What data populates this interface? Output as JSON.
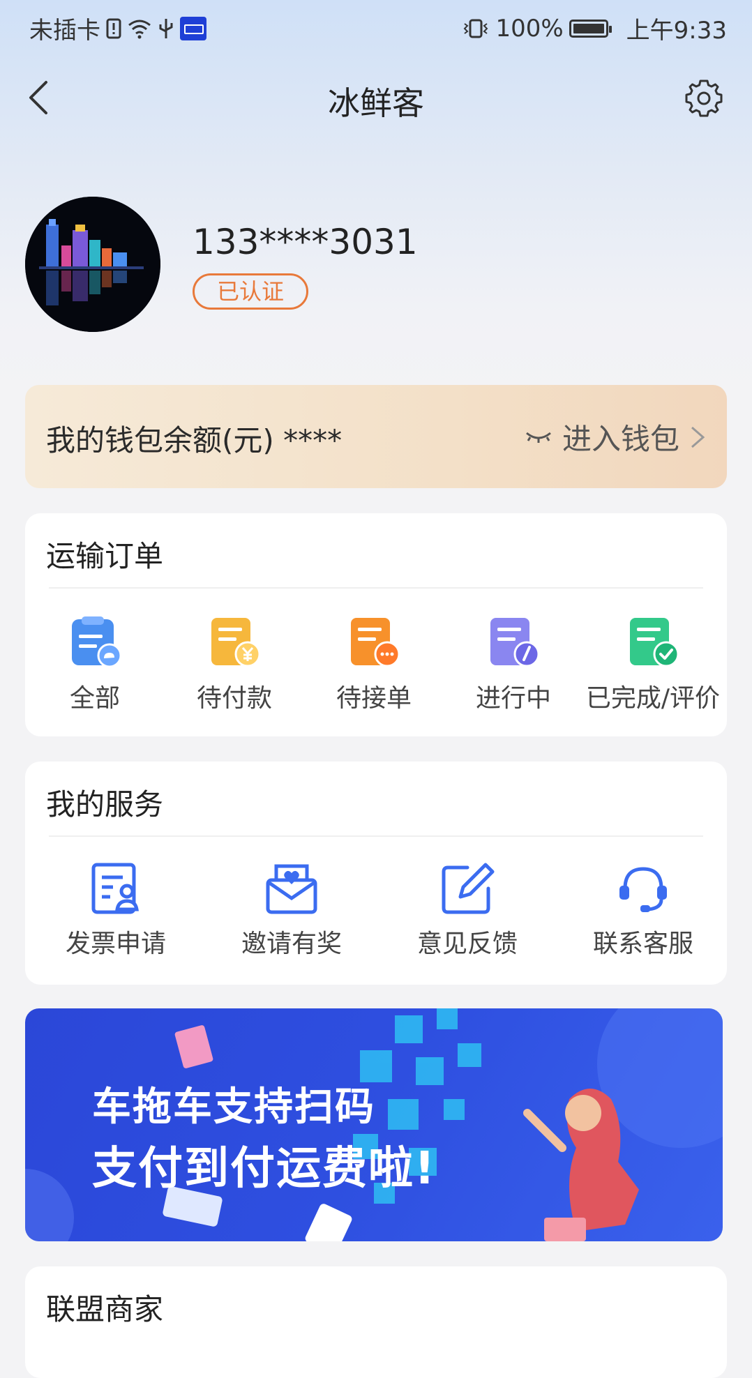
{
  "status_bar": {
    "carrier": "未插卡",
    "battery_percent": "100%",
    "time": "上午9:33"
  },
  "header": {
    "title": "冰鲜客"
  },
  "profile": {
    "phone": "133****3031",
    "verified_label": "已认证"
  },
  "wallet": {
    "label": "我的钱包余额(元) ****",
    "enter_label": "进入钱包"
  },
  "orders": {
    "title": "运输订单",
    "items": [
      {
        "label": "全部",
        "icon": "clipboard-cloud-icon",
        "color": "#4a8ff0"
      },
      {
        "label": "待付款",
        "icon": "receipt-yen-icon",
        "color": "#f6b73c"
      },
      {
        "label": "待接单",
        "icon": "document-pending-icon",
        "color": "#f7912b"
      },
      {
        "label": "进行中",
        "icon": "document-progress-icon",
        "color": "#8a86f0"
      },
      {
        "label": "已完成/评价",
        "icon": "document-check-icon",
        "color": "#33c98a"
      }
    ]
  },
  "services": {
    "title": "我的服务",
    "items": [
      {
        "label": "发票申请",
        "icon": "invoice-icon"
      },
      {
        "label": "邀请有奖",
        "icon": "invite-mail-heart-icon"
      },
      {
        "label": "意见反馈",
        "icon": "feedback-edit-icon"
      },
      {
        "label": "联系客服",
        "icon": "headset-icon"
      }
    ],
    "accent": "#3b6cf0"
  },
  "banner": {
    "line1": "车拖车支持扫码",
    "line2": "支付到付运费啦!"
  },
  "alliance": {
    "title": "联盟商家"
  }
}
